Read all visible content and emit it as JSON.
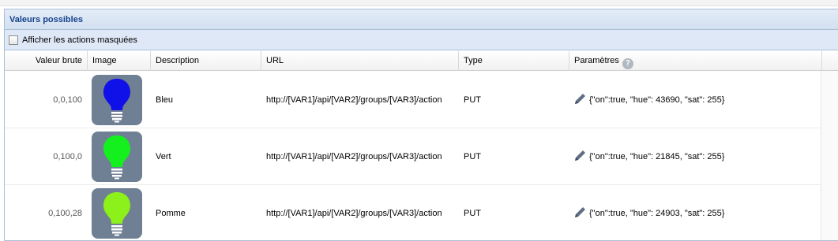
{
  "panel": {
    "title": "Valeurs possibles"
  },
  "toolbar": {
    "show_hidden_label": "Afficher les actions masquées",
    "show_hidden_checked": false
  },
  "columns": {
    "raw": "Valeur brute",
    "image": "Image",
    "description": "Description",
    "url": "URL",
    "type": "Type",
    "params": "Paramètres"
  },
  "rows": [
    {
      "raw": "0,0,100",
      "bulb_icon": "lightbulb-icon",
      "bulb_color": "#1010e8",
      "description": "Bleu",
      "url": "http://[VAR1]/api/[VAR2]/groups/[VAR3]/action",
      "type": "PUT",
      "params": "{\"on\":true, \"hue\": 43690, \"sat\": 255}"
    },
    {
      "raw": "0,100,0",
      "bulb_icon": "lightbulb-icon",
      "bulb_color": "#14f01e",
      "description": "Vert",
      "url": "http://[VAR1]/api/[VAR2]/groups/[VAR3]/action",
      "type": "PUT",
      "params": "{\"on\":true, \"hue\": 21845, \"sat\": 255}"
    },
    {
      "raw": "0,100,28",
      "bulb_icon": "lightbulb-icon",
      "bulb_color": "#8cf01a",
      "description": "Pomme",
      "url": "http://[VAR1]/api/[VAR2]/groups/[VAR3]/action",
      "type": "PUT",
      "params": "{\"on\":true, \"hue\": 24903, \"sat\": 255}"
    }
  ]
}
